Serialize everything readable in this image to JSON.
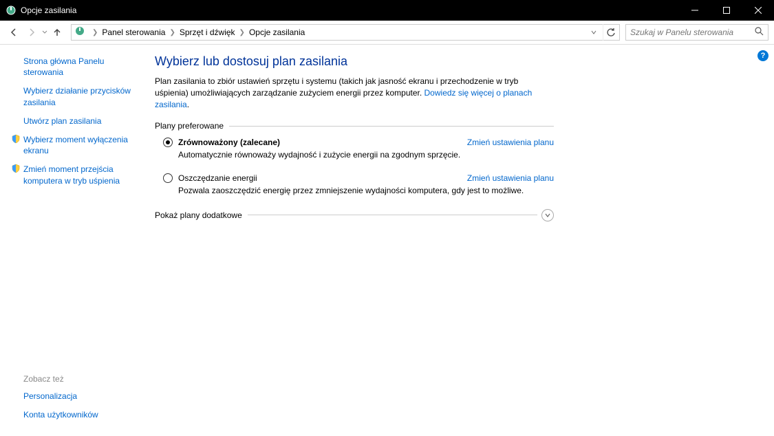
{
  "window": {
    "title": "Opcje zasilania"
  },
  "breadcrumb": {
    "items": [
      "Panel sterowania",
      "Sprzęt i dźwięk",
      "Opcje zasilania"
    ]
  },
  "search": {
    "placeholder": "Szukaj w Panelu sterowania"
  },
  "sidebar": {
    "home": "Strona główna Panelu sterowania",
    "links": [
      "Wybierz działanie przycisków zasilania",
      "Utwórz plan zasilania",
      "Wybierz moment wyłączenia ekranu",
      "Zmień moment przejścia komputera w tryb uśpienia"
    ],
    "see_also_label": "Zobacz też",
    "see_also": [
      "Personalizacja",
      "Konta użytkowników"
    ]
  },
  "content": {
    "heading": "Wybierz lub dostosuj plan zasilania",
    "desc_pre": "Plan zasilania to zbiór ustawień sprzętu i systemu (takich jak jasność ekranu i przechodzenie w tryb uśpienia) umożliwiających zarządzanie zużyciem energii przez komputer. ",
    "desc_link": "Dowiedz się więcej o planach zasilania",
    "preferred_label": "Plany preferowane",
    "plans": [
      {
        "name": "Zrównoważony (zalecane)",
        "desc": "Automatycznie równoważy wydajność i zużycie energii na zgodnym sprzęcie.",
        "change": "Zmień ustawienia planu",
        "selected": true
      },
      {
        "name": "Oszczędzanie energii",
        "desc": "Pozwala zaoszczędzić energię przez zmniejszenie wydajności komputera, gdy jest to możliwe.",
        "change": "Zmień ustawienia planu",
        "selected": false
      }
    ],
    "additional_label": "Pokaż plany dodatkowe"
  }
}
